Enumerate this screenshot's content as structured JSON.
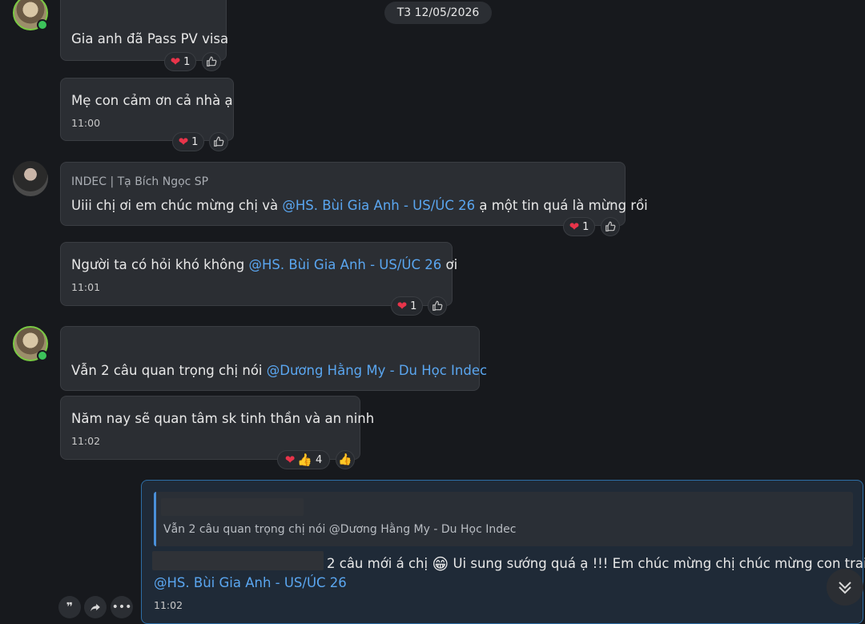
{
  "date_separator": "T3 12/05/2026",
  "messages": [
    {
      "text": "Gia anh đã Pass PV visa",
      "reactions": {
        "heart_count": "1"
      }
    },
    {
      "text": "Mẹ con cảm ơn cả nhà ạ",
      "time": "11:00",
      "reactions": {
        "heart_count": "1"
      }
    },
    {
      "sender": "INDEC | Tạ Bích Ngọc SP",
      "text_before": "Uiii chị ơi em chúc mừng chị và ",
      "mention": "@HS. Bùi Gia Anh - US/ÚC 26",
      "text_after": " ạ một tin quá là mừng rồi",
      "reactions": {
        "heart_count": "1"
      }
    },
    {
      "text_before": "Người ta có hỏi khó không ",
      "mention": "@HS. Bùi Gia Anh - US/ÚC 26",
      "text_after": " ơi",
      "time": "11:01",
      "reactions": {
        "heart_count": "1"
      }
    },
    {
      "text_before": "Vẫn 2 câu quan trọng chị nói ",
      "mention": "@Dương Hằng My - Du Học Indec"
    },
    {
      "text": "Năm nay sẽ quan tâm sk tinh thần và an ninh",
      "time": "11:02",
      "reactions": {
        "total_count": "4"
      }
    },
    {
      "quote": "Vẫn 2 câu quan trọng chị nói @Dương Hằng My - Du Học Indec",
      "text_part1": "2 câu mới á chị",
      "emoji": "😁",
      "text_part2": "Ui sung sướng quá ạ !!! Em chúc mừng chị chúc mừng con trai",
      "mention": "@HS. Bùi Gia Anh - US/ÚC 26",
      "time": "11:02"
    }
  ],
  "icons": {
    "heart": "heart-icon",
    "thumbs_up": "thumbs-up-icon",
    "like_outline": "like-outline-icon",
    "quote": "quote-icon",
    "forward": "forward-icon",
    "more": "more-icon",
    "scroll_down": "chevron-double-down-icon"
  },
  "colors": {
    "mention": "#5aa6f0",
    "background": "#17191d",
    "bubble": "#2b2e33",
    "highlight_border": "#2d6ea6"
  }
}
